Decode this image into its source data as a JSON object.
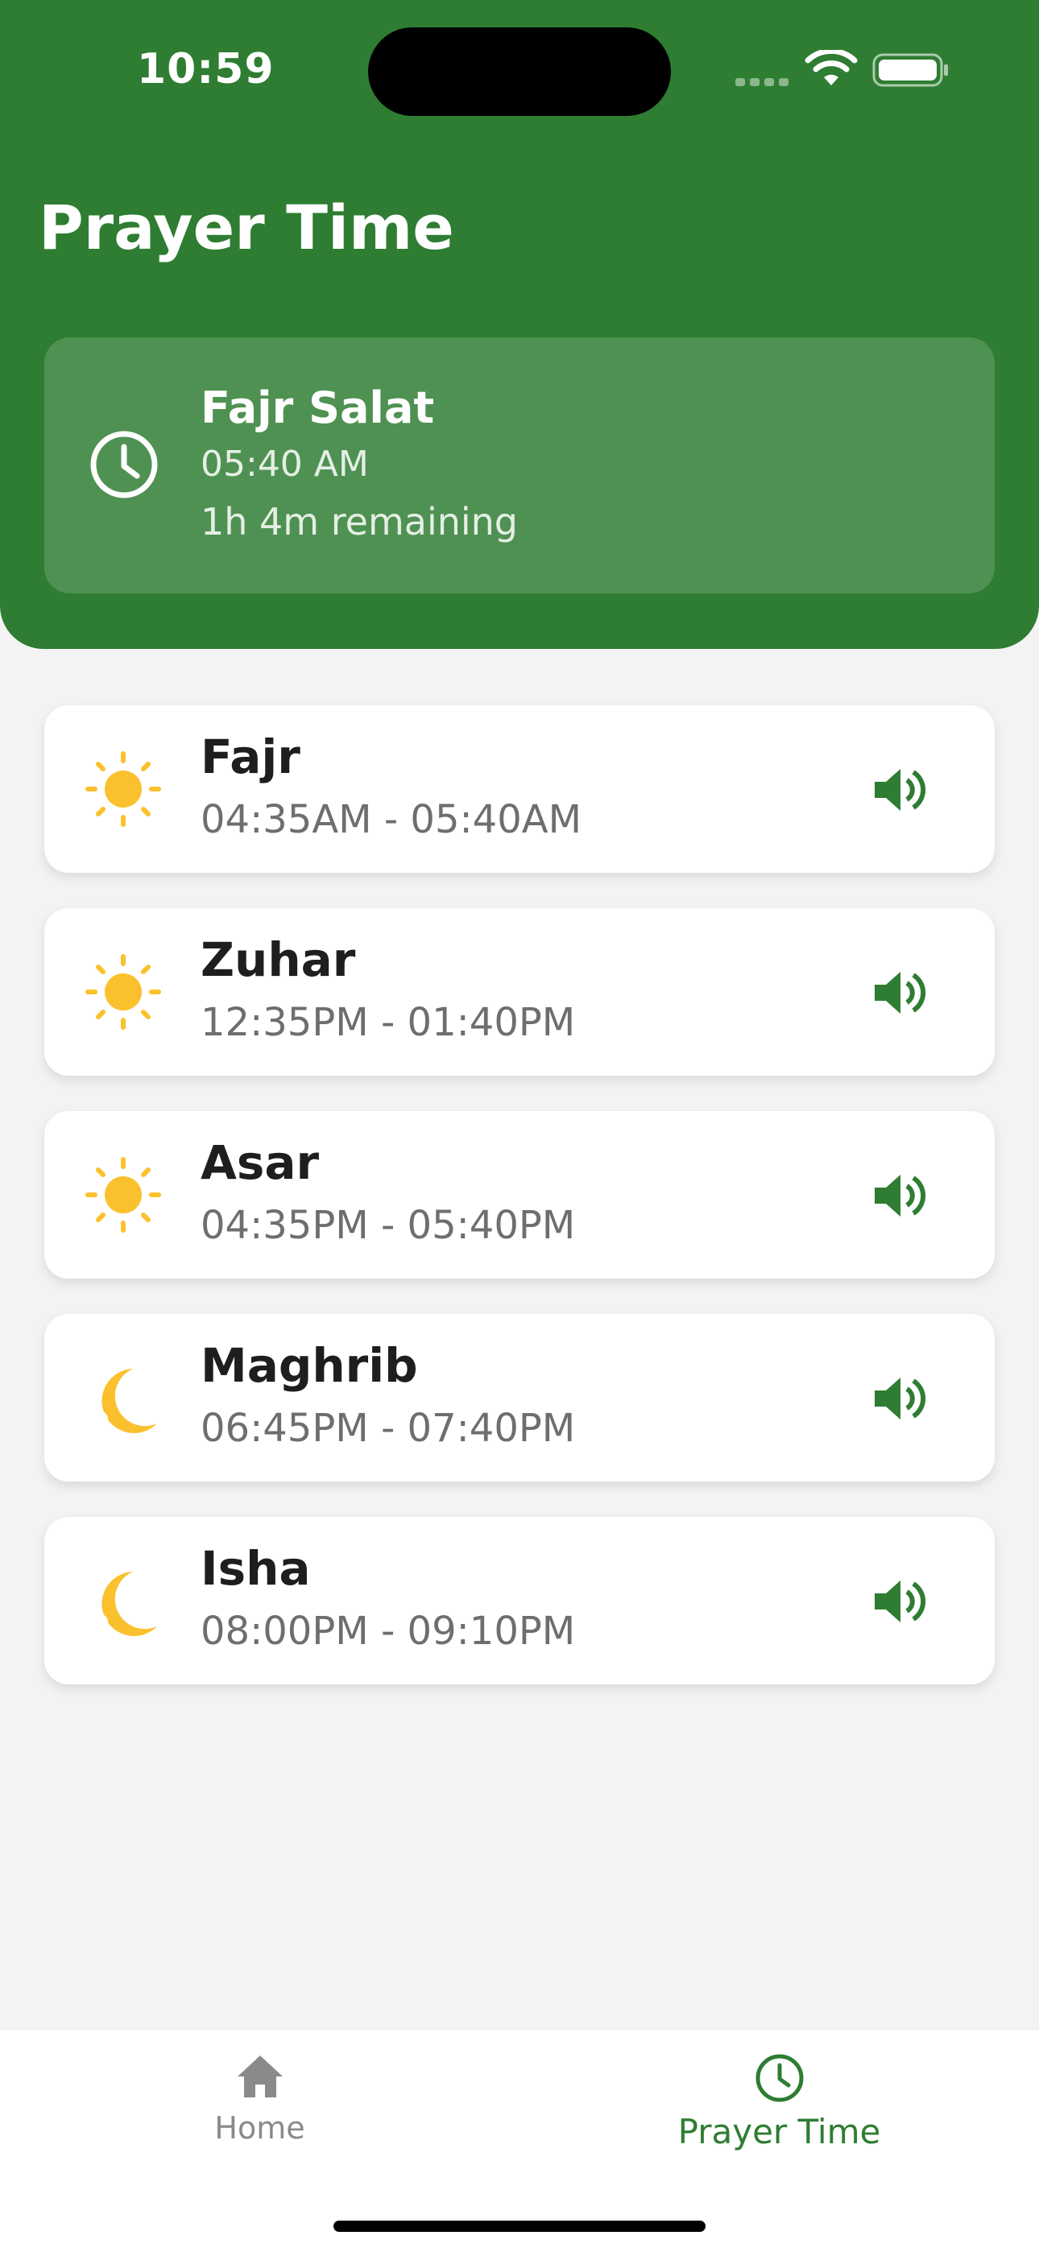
{
  "status_bar": {
    "time": "10:59"
  },
  "app": {
    "title": "Prayer Time"
  },
  "next_prayer": {
    "title": "Fajr Salat",
    "time": "05:40 AM",
    "remaining": "1h 4m remaining",
    "icon": "clock-icon"
  },
  "prayers": [
    {
      "name": "Fajr",
      "range": "04:35AM - 05:40AM",
      "icon": "sun-icon"
    },
    {
      "name": "Zuhar",
      "range": "12:35PM - 01:40PM",
      "icon": "sun-icon"
    },
    {
      "name": "Asar",
      "range": "04:35PM - 05:40PM",
      "icon": "sun-icon"
    },
    {
      "name": "Maghrib",
      "range": "06:45PM - 07:40PM",
      "icon": "moon-icon"
    },
    {
      "name": "Isha",
      "range": "08:00PM - 09:10PM",
      "icon": "moon-icon"
    }
  ],
  "bottom_nav": {
    "items": [
      {
        "label": "Home",
        "icon": "home-icon",
        "active": false
      },
      {
        "label": "Prayer Time",
        "icon": "clock-icon",
        "active": true
      }
    ]
  },
  "colors": {
    "primary": "#2e7d32",
    "accent": "#fbc02d",
    "background": "#f3f3f3"
  }
}
